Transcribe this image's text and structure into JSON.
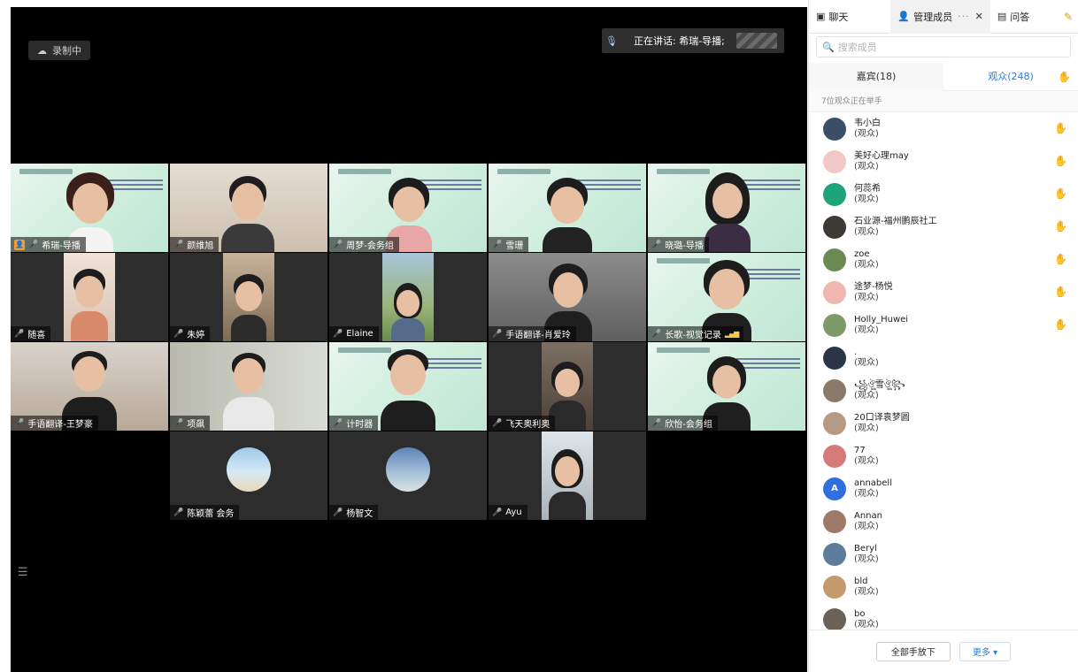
{
  "stage": {
    "recording_label": "录制中",
    "speaking_label": "正在讲话: 希瑞-导播;"
  },
  "tiles": [
    {
      "name": "希瑞-导播"
    },
    {
      "name": "颜维旭"
    },
    {
      "name": "周梦-会务组"
    },
    {
      "name": "雪珊"
    },
    {
      "name": "晓璐-导播"
    },
    {
      "name": "随喜"
    },
    {
      "name": "朱婷"
    },
    {
      "name": "Elaine"
    },
    {
      "name": "手语翻译-肖爱玲"
    },
    {
      "name": "长歌-视觉记录"
    },
    {
      "name": "手语翻译-王梦豪"
    },
    {
      "name": "项飙"
    },
    {
      "name": "计时器"
    },
    {
      "name": "飞天奥利奥"
    },
    {
      "name": "欣怡-会务组"
    },
    {
      "name": "陈颖蕾 会务"
    },
    {
      "name": "杨智文"
    },
    {
      "name": "Ayu"
    }
  ],
  "panel": {
    "tabs": {
      "chat": "聊天",
      "members": "管理成员",
      "qa": "问答"
    },
    "search_placeholder": "搜索成员",
    "guests_tab": "嘉宾(18)",
    "audience_tab": "观众(248)",
    "hand_raise_count": "7位观众正在举手",
    "members": [
      {
        "name": "韦小白",
        "role": "(观众)",
        "avatar_color": "#3a4f66",
        "hand": true
      },
      {
        "name": "美好心理may",
        "role": "(观众)",
        "avatar_color": "#f2c7c7",
        "hand": true
      },
      {
        "name": "何蕊希",
        "role": "(观众)",
        "avatar_color": "#1fa37a",
        "hand": true
      },
      {
        "name": "石业源-福州鹏辰社工",
        "role": "(观众)",
        "avatar_color": "#3d3a35",
        "hand": true
      },
      {
        "name": "zoe",
        "role": "(观众)",
        "avatar_color": "#6a8a52",
        "hand": true
      },
      {
        "name": "途梦-杨悦",
        "role": "(观众)",
        "avatar_color": "#f0b6b0",
        "hand": true
      },
      {
        "name": "Holly_Huwei",
        "role": "(观众)",
        "avatar_color": "#7f9a6a",
        "hand": true
      },
      {
        "name": ".",
        "role": "(观众)",
        "avatar_color": "#2c3448",
        "hand": false
      },
      {
        "name": "꧁ঔৣ雪ঔৣ꧂",
        "role": "(观众)",
        "avatar_color": "#8a7a6a",
        "hand": false
      },
      {
        "name": "20口译袁梦圆",
        "role": "(观众)",
        "avatar_color": "#b59a86",
        "hand": false
      },
      {
        "name": "77",
        "role": "(观众)",
        "avatar_color": "#d67a7a",
        "hand": false
      },
      {
        "name": "annabell",
        "role": "(观众)",
        "avatar_color": "#2f6fe0",
        "avatar_text": "A",
        "hand": false
      },
      {
        "name": "Annan",
        "role": "(观众)",
        "avatar_color": "#a07a68",
        "hand": false
      },
      {
        "name": "Beryl",
        "role": "(观众)",
        "avatar_color": "#5d7d9a",
        "hand": false
      },
      {
        "name": "bld",
        "role": "(观众)",
        "avatar_color": "#c49a6c",
        "hand": false
      },
      {
        "name": "bo",
        "role": "(观众)",
        "avatar_color": "#6b6157",
        "hand": false
      }
    ],
    "footer": {
      "lower_all": "全部手放下",
      "more": "更多 ▾"
    }
  },
  "colors": {
    "accent": "#2d7be5",
    "active_speaker_border": "#3bb54a",
    "stage_background": "#000000"
  }
}
